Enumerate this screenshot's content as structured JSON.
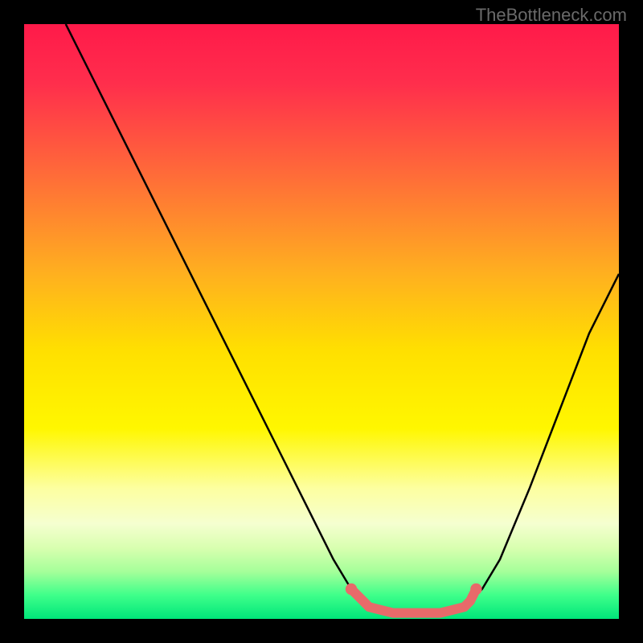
{
  "watermark": "TheBottleneck.com",
  "chart_data": {
    "type": "line",
    "title": "",
    "xlabel": "",
    "ylabel": "",
    "xlim": [
      0,
      100
    ],
    "ylim": [
      0,
      100
    ],
    "background": {
      "type": "vertical-gradient",
      "stops": [
        {
          "offset": 0,
          "color": "#ff1a4a"
        },
        {
          "offset": 10,
          "color": "#ff2e4c"
        },
        {
          "offset": 25,
          "color": "#ff6a39"
        },
        {
          "offset": 42,
          "color": "#ffb01f"
        },
        {
          "offset": 55,
          "color": "#ffe000"
        },
        {
          "offset": 68,
          "color": "#fff700"
        },
        {
          "offset": 78,
          "color": "#fdffa0"
        },
        {
          "offset": 84,
          "color": "#f5ffd0"
        },
        {
          "offset": 88,
          "color": "#d9ffb0"
        },
        {
          "offset": 92,
          "color": "#a6ff9a"
        },
        {
          "offset": 96,
          "color": "#3fff8a"
        },
        {
          "offset": 100,
          "color": "#00e67a"
        }
      ]
    },
    "series": [
      {
        "name": "bottleneck-curve",
        "stroke": "#000000",
        "width": 2.5,
        "points": [
          {
            "x": 7,
            "y": 100
          },
          {
            "x": 12,
            "y": 90
          },
          {
            "x": 18,
            "y": 78
          },
          {
            "x": 24,
            "y": 66
          },
          {
            "x": 30,
            "y": 54
          },
          {
            "x": 36,
            "y": 42
          },
          {
            "x": 42,
            "y": 30
          },
          {
            "x": 48,
            "y": 18
          },
          {
            "x": 52,
            "y": 10
          },
          {
            "x": 55,
            "y": 5
          },
          {
            "x": 58,
            "y": 2
          },
          {
            "x": 62,
            "y": 1
          },
          {
            "x": 66,
            "y": 1
          },
          {
            "x": 70,
            "y": 1
          },
          {
            "x": 74,
            "y": 2
          },
          {
            "x": 77,
            "y": 5
          },
          {
            "x": 80,
            "y": 10
          },
          {
            "x": 85,
            "y": 22
          },
          {
            "x": 90,
            "y": 35
          },
          {
            "x": 95,
            "y": 48
          },
          {
            "x": 100,
            "y": 58
          }
        ]
      }
    ],
    "markers": {
      "name": "highlight-dots",
      "color": "#e86a6a",
      "radius": 6,
      "points": [
        {
          "x": 55,
          "y": 5
        },
        {
          "x": 57,
          "y": 3
        },
        {
          "x": 58,
          "y": 2
        },
        {
          "x": 60,
          "y": 1.5
        },
        {
          "x": 62,
          "y": 1
        },
        {
          "x": 64,
          "y": 1
        },
        {
          "x": 66,
          "y": 1
        },
        {
          "x": 68,
          "y": 1
        },
        {
          "x": 70,
          "y": 1
        },
        {
          "x": 72,
          "y": 1.5
        },
        {
          "x": 74,
          "y": 2
        },
        {
          "x": 75,
          "y": 3
        },
        {
          "x": 76,
          "y": 5
        }
      ]
    }
  }
}
